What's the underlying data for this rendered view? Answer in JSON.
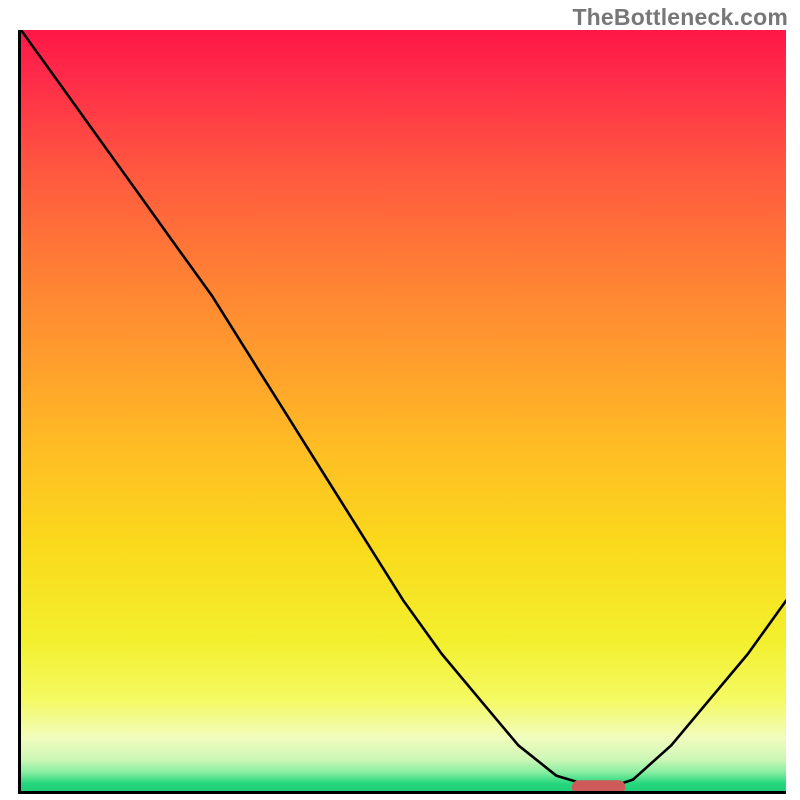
{
  "watermark": "TheBottleneck.com",
  "colors": {
    "gradient_top": "#ff1846",
    "gradient_bottom": "#20d07a",
    "curve": "#000000",
    "marker": "#cf5a5a"
  },
  "chart_data": {
    "type": "line",
    "title": "",
    "xlabel": "",
    "ylabel": "",
    "xlim": [
      0,
      100
    ],
    "ylim": [
      0,
      100
    ],
    "x": [
      0,
      5,
      10,
      15,
      20,
      25,
      30,
      35,
      40,
      45,
      50,
      55,
      60,
      65,
      70,
      75,
      77,
      80,
      85,
      90,
      95,
      100
    ],
    "y": [
      100,
      93,
      86,
      79,
      72,
      65,
      57,
      49,
      41,
      33,
      25,
      18,
      12,
      6,
      2,
      0.5,
      0.5,
      1.5,
      6,
      12,
      18,
      25
    ],
    "marker": {
      "x_start": 72,
      "x_end": 79,
      "y": 0.5
    }
  }
}
